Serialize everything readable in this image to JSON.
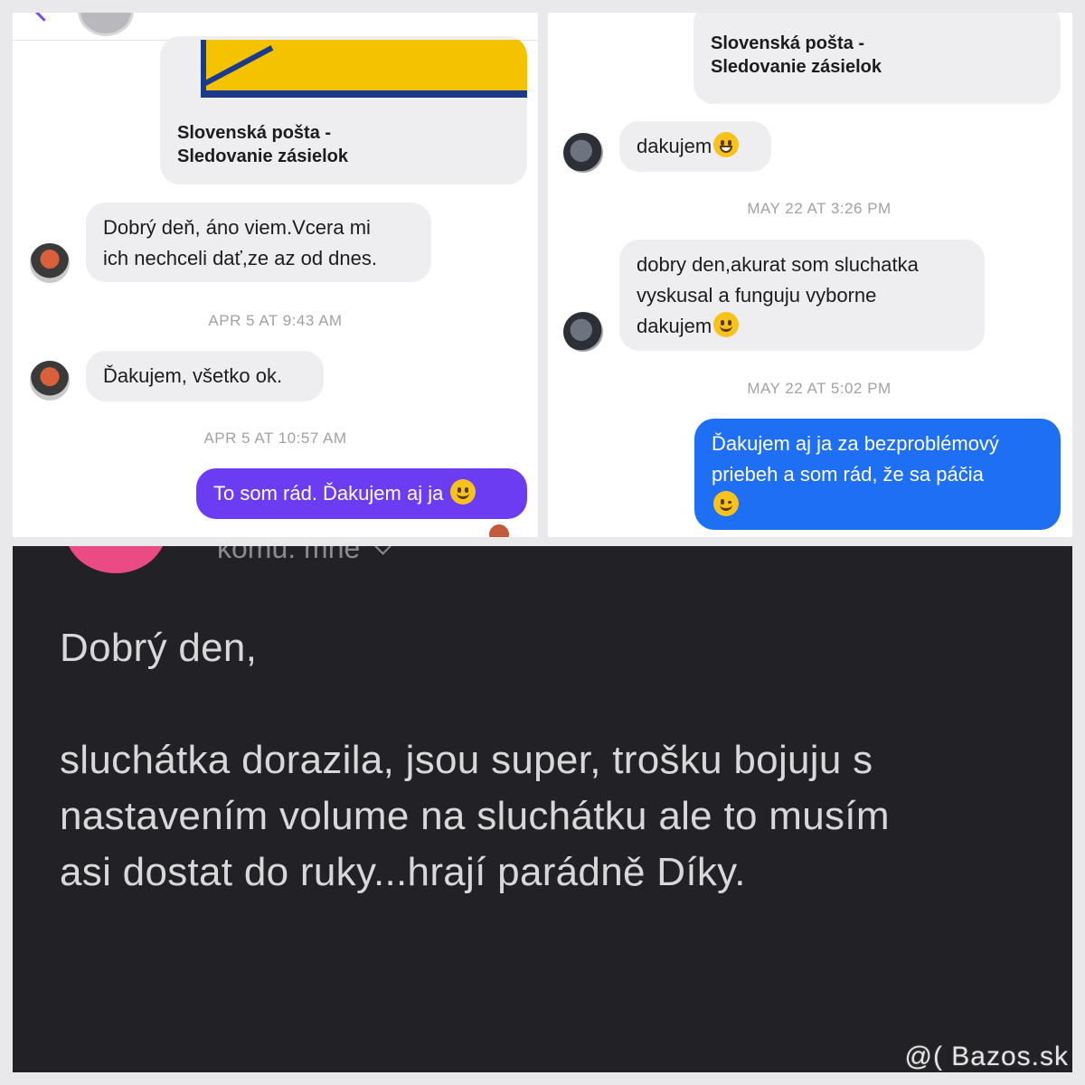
{
  "colors": {
    "incoming_bubble": "#eeeef0",
    "outgoing_bubble_left": "#6b3cf2",
    "outgoing_bubble_right": "#1f6ff5",
    "dark_panel": "#222226",
    "pink_avatar": "#e94b82",
    "posta_yellow": "#f4c300",
    "posta_blue": "#1a3a8c"
  },
  "left_chat": {
    "link_card": {
      "title_line1": "Slovenská pošta -",
      "title_line2": "Sledovanie zásielok"
    },
    "messages": [
      {
        "line1": "Dobrý deň, áno viem.Vcera mi",
        "line2": "ich nechceli dať,ze az od dnes."
      }
    ],
    "stamp1": "APR 5 AT 9:43 AM",
    "message2": "Ďakujem, všetko ok.",
    "stamp2": "APR 5 AT 10:57 AM",
    "outgoing": "To som rád. Ďakujem aj ja",
    "outgoing_emoji": "smile-emoji"
  },
  "right_chat": {
    "link_card": {
      "title_line1": "Slovenská pošta -",
      "title_line2": "Sledovanie zásielok"
    },
    "message1": "dakujem",
    "message1_emoji": "grin-emoji",
    "stamp1": "MAY 22 AT 3:26 PM",
    "message2": {
      "line1": "dobry den,akurat som sluchatka",
      "line2": "vyskusal a funguju vyborne",
      "line3": "dakujem"
    },
    "message2_emoji": "smile-emoji",
    "stamp2": "MAY 22 AT 5:02 PM",
    "outgoing": {
      "line1": "Ďakujem aj ja za bezproblémový",
      "line2": "priebeh a som rád, že sa páčia"
    },
    "outgoing_emoji": "wink-emoji"
  },
  "email": {
    "recipient": "komu: mne",
    "greeting": "Dobrý den,",
    "body_line1": "sluchátka dorazila, jsou super, trošku bojuju s",
    "body_line2": "nastavením volume na sluchátku ale to musím",
    "body_line3": "asi dostat do ruky...hrají parádně Díky."
  },
  "watermark": "@( Bazos.sk"
}
